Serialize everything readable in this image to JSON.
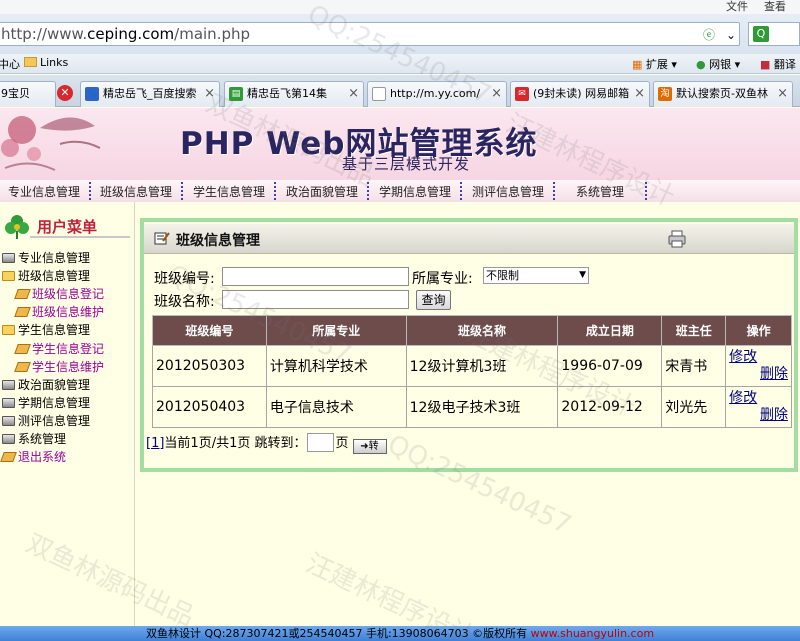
{
  "browser": {
    "menu": {
      "file": "文件",
      "view": "查看"
    },
    "address": {
      "prefix": "http://www.",
      "domain": "ceping.com",
      "path": "/main.php"
    },
    "toolbar": {
      "extend": "扩展",
      "netbank": "网银",
      "translate": "翻译"
    },
    "favorites": {
      "center": "中心",
      "links": "Links"
    },
    "tabs": [
      {
        "label": "9宝贝"
      },
      {
        "label": "精忠岳飞_百度搜索"
      },
      {
        "label": "精忠岳飞第14集"
      },
      {
        "label": "http://m.yy.com/"
      },
      {
        "label": "(9封未读) 网易邮箱"
      },
      {
        "label": "默认搜索页-双鱼林"
      }
    ]
  },
  "header": {
    "title": "PHP Web网站管理系统",
    "subtitle": "基于三层模式开发"
  },
  "topnav": [
    "专业信息管理",
    "班级信息管理",
    "学生信息管理",
    "政治面貌管理",
    "学期信息管理",
    "测评信息管理",
    "系统管理"
  ],
  "sidebar": {
    "title": "用户菜单",
    "items": [
      {
        "label": "专业信息管理",
        "type": "closed"
      },
      {
        "label": "班级信息管理",
        "type": "open"
      },
      {
        "label": "班级信息登记",
        "type": "leaf"
      },
      {
        "label": "班级信息维护",
        "type": "leaf"
      },
      {
        "label": "学生信息管理",
        "type": "open"
      },
      {
        "label": "学生信息登记",
        "type": "leaf"
      },
      {
        "label": "学生信息维护",
        "type": "leaf"
      },
      {
        "label": "政治面貌管理",
        "type": "closed"
      },
      {
        "label": "学期信息管理",
        "type": "closed"
      },
      {
        "label": "测评信息管理",
        "type": "closed"
      },
      {
        "label": "系统管理",
        "type": "closed"
      },
      {
        "label": "退出系统",
        "type": "leaf"
      }
    ]
  },
  "panel": {
    "title": "班级信息管理",
    "query": {
      "class_no_label": "班级编号:",
      "major_label": "所属专业:",
      "major_value": "不限制",
      "class_name_label": "班级名称:",
      "search_button": "查询"
    },
    "table": {
      "headers": [
        "班级编号",
        "所属专业",
        "班级名称",
        "成立日期",
        "班主任",
        "操作"
      ],
      "rows": [
        {
          "no": "2012050303",
          "major": "计算机科学技术",
          "name": "12级计算机3班",
          "date": "1996-07-09",
          "teacher": "宋青书",
          "edit": "修改",
          "del": "删除"
        },
        {
          "no": "2012050403",
          "major": "电子信息技术",
          "name": "12级电子技术3班",
          "date": "2012-09-12",
          "teacher": "刘光先",
          "edit": "修改",
          "del": "删除"
        }
      ]
    },
    "pager": {
      "page_link": "[1]",
      "info": "当前1页/共1页 跳转到：",
      "page_unit": "页",
      "go_button": "➜转"
    }
  },
  "footer": {
    "text": "双鱼林设计 QQ:287307421或254540457 手机:13908064703 ©版权所有",
    "link": "www.shuangyulin.com"
  },
  "watermarks": [
    "QQ:254540457",
    "双鱼林源码出品",
    "汪建林程序设计",
    "QQ:254540457",
    "汪建林程序设计",
    "双鱼林源码出品",
    "QQ:254540457",
    "汪建林程序设计"
  ]
}
